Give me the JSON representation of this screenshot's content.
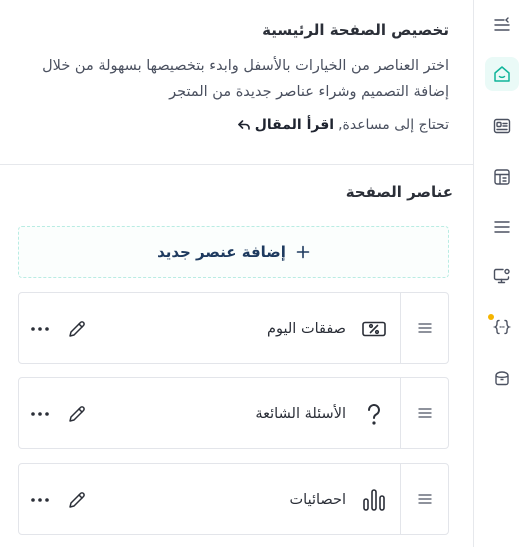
{
  "intro": {
    "title": "تخصيص الصفحة الرئيسية",
    "description": "اختر العناصر من الخيارات بالأسفل وابدء بتخصيصها بسهولة من خلال إضافة التصميم وشراء عناصر جديدة من المتجر",
    "help_prefix": "تحتاج إلى مساعدة,",
    "help_link": "اقرأ المقال"
  },
  "section": {
    "title": "عناصر الصفحة",
    "add_label": "إضافة عنصر جديد"
  },
  "elements": [
    {
      "name": "صفقات اليوم",
      "icon": "percent-tag-icon"
    },
    {
      "name": "الأسئلة الشائعة",
      "icon": "question-icon"
    },
    {
      "name": "احصائيات",
      "icon": "bar-stats-icon"
    }
  ],
  "sidebar": {
    "items": [
      {
        "icon": "collapse-menu-icon"
      },
      {
        "icon": "home-smile-icon",
        "active": true
      },
      {
        "icon": "id-card-icon"
      },
      {
        "icon": "layout-icon"
      },
      {
        "icon": "menu-lines-icon"
      },
      {
        "icon": "monitor-gear-icon"
      },
      {
        "icon": "code-braces-icon",
        "badge": true
      },
      {
        "icon": "box-icon"
      }
    ]
  },
  "colors": {
    "accent": "#0fb59a",
    "badge": "#f5b400",
    "text": "#2b2f38"
  }
}
